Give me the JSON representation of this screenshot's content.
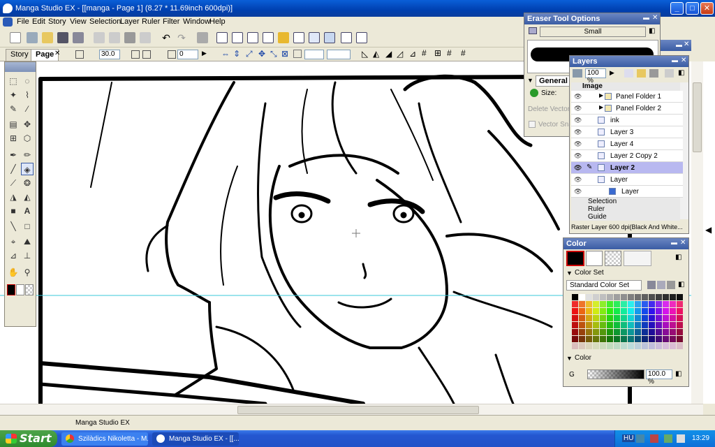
{
  "window": {
    "title": "Manga Studio EX - [[manga - Page 1] (8.27 * 11.69inch 600dpi)]"
  },
  "menu": [
    "File",
    "Edit",
    "Story",
    "View",
    "Selection",
    "Layer",
    "Ruler",
    "Filter",
    "Window",
    "Help"
  ],
  "tabs": {
    "story": "Story",
    "page": "Page"
  },
  "toolbar2": {
    "brush_size": "30.0",
    "angle": "0"
  },
  "eraser_options": {
    "title": "Eraser Tool Options",
    "size_name": "Small",
    "section": "General",
    "size_label": "Size:",
    "delete_vector": "Delete Vector",
    "vector_snap": "Vector Snap"
  },
  "layers": {
    "title": "Layers",
    "opacity": "100 %",
    "group": "Image",
    "items": [
      {
        "name": "Panel Folder 1",
        "selected": false
      },
      {
        "name": "Panel Folder 2",
        "selected": false
      },
      {
        "name": "ink",
        "selected": false
      },
      {
        "name": "Layer 3",
        "selected": false
      },
      {
        "name": "Layer 4",
        "selected": false
      },
      {
        "name": "Layer 2 Copy 2",
        "selected": false
      },
      {
        "name": "Layer 2",
        "selected": true
      },
      {
        "name": "Layer",
        "selected": false
      },
      {
        "name": "Layer",
        "selected": false
      }
    ],
    "sections": [
      "Selection",
      "Ruler",
      "Guide"
    ],
    "status": "Raster Layer 600 dpi(Black And White..."
  },
  "color": {
    "title": "Color",
    "set_header": "Color Set",
    "set_name": "Standard Color Set",
    "section": "Color",
    "channel": "G",
    "value": "100.0 %"
  },
  "status_text": "Manga Studio EX",
  "taskbar": {
    "start": "Start",
    "items": [
      "Szilàdics Nikoletta - M...",
      "Manga Studio EX - [[..."
    ],
    "lang": "HU",
    "clock": "13:29"
  }
}
